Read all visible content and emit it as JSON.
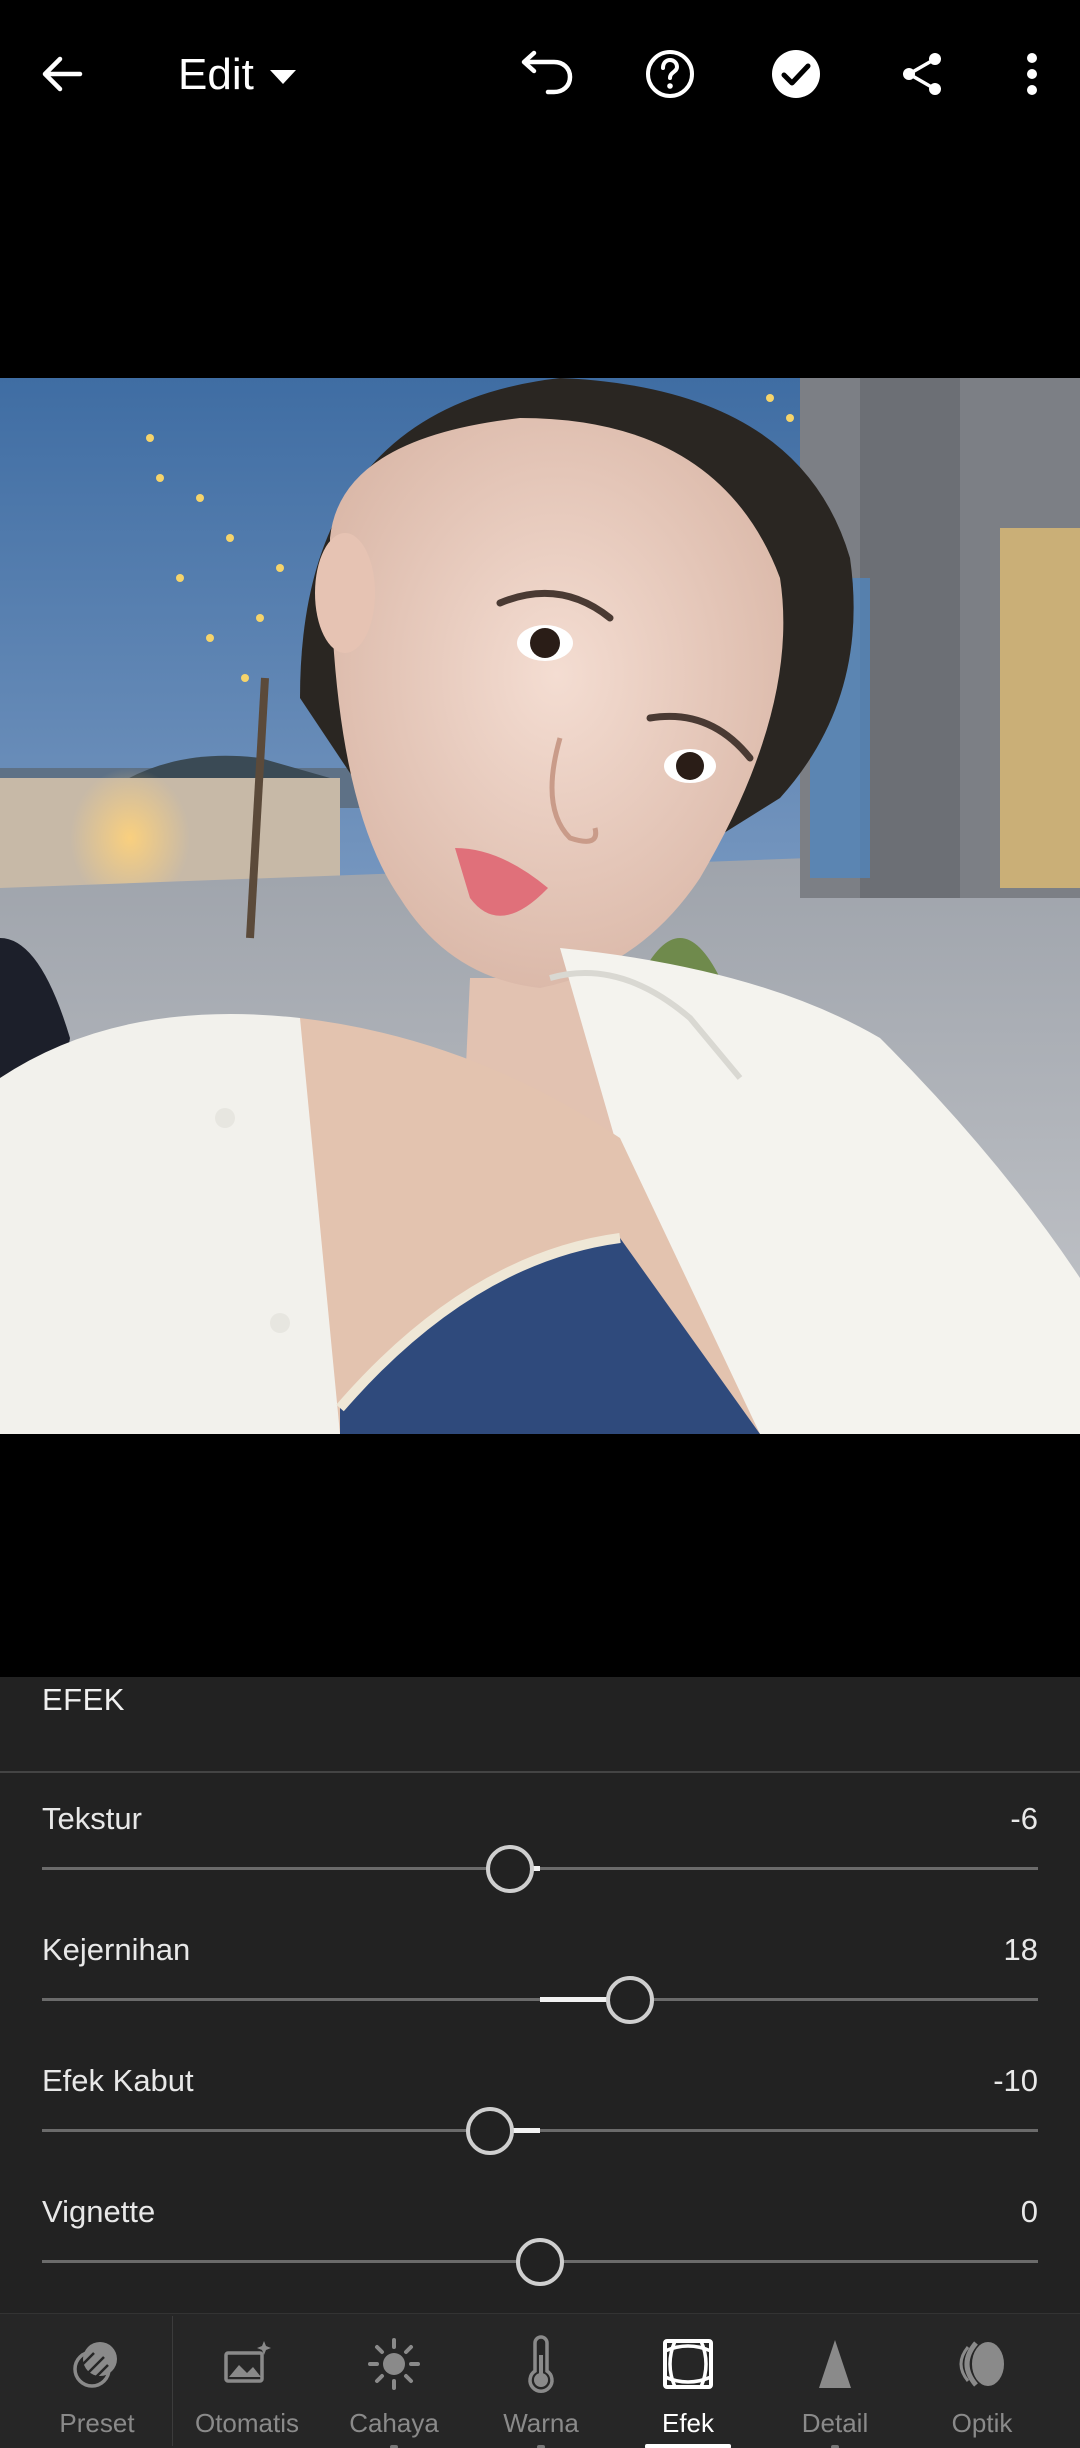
{
  "header": {
    "edit_label": "Edit",
    "icons": [
      "back-arrow-icon",
      "undo-icon",
      "help-icon",
      "checkmark-icon",
      "share-icon",
      "more-vert-icon"
    ]
  },
  "panel": {
    "title": "EFEK",
    "sliders": [
      {
        "label": "Tekstur",
        "value": "-6",
        "level": -6
      },
      {
        "label": "Kejernihan",
        "value": "18",
        "level": 18
      },
      {
        "label": "Efek Kabut",
        "value": "-10",
        "level": -10
      },
      {
        "label": "Vignette",
        "value": "0",
        "level": 0
      }
    ],
    "slider_range": [
      -100,
      100
    ]
  },
  "nav": {
    "items": [
      {
        "label": "Preset",
        "icon": "preset-icon"
      },
      {
        "label": "Otomatis",
        "icon": "auto-icon"
      },
      {
        "label": "Cahaya",
        "icon": "light-sun-icon"
      },
      {
        "label": "Warna",
        "icon": "thermometer-icon"
      },
      {
        "label": "Efek",
        "icon": "effects-icon"
      },
      {
        "label": "Detail",
        "icon": "detail-triangle-icon"
      },
      {
        "label": "Optik",
        "icon": "optics-lens-icon"
      }
    ],
    "active": "Efek"
  },
  "colors": {
    "background": "#000000",
    "panel": "#222222",
    "nav": "#262626",
    "accent": "#ffffff"
  }
}
